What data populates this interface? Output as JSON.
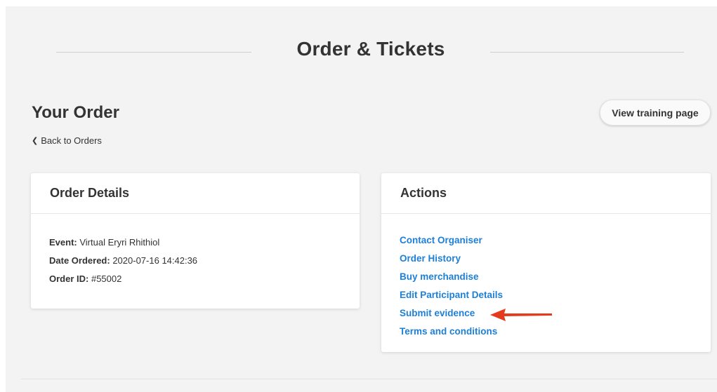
{
  "header": {
    "title": "Order & Tickets"
  },
  "order": {
    "heading": "Your Order",
    "view_button": "View training page",
    "back_link": "Back to Orders"
  },
  "details": {
    "title": "Order Details",
    "event_label": "Event:",
    "event_value": "Virtual Eryri Rhithiol",
    "date_label": "Date Ordered:",
    "date_value": "2020-07-16 14:42:36",
    "id_label": "Order ID:",
    "id_value": "#55002"
  },
  "actions": {
    "title": "Actions",
    "items": [
      {
        "label": "Contact Organiser"
      },
      {
        "label": "Order History"
      },
      {
        "label": "Buy merchandise"
      },
      {
        "label": "Edit Participant Details"
      },
      {
        "label": "Submit evidence"
      },
      {
        "label": "Terms and conditions"
      }
    ]
  },
  "colors": {
    "link": "#1d7fd6",
    "arrow": "#e53a1d",
    "background": "#f3f3f3"
  },
  "icons": {
    "back": "chevron-left-icon",
    "annotation": "red-arrow-icon"
  }
}
